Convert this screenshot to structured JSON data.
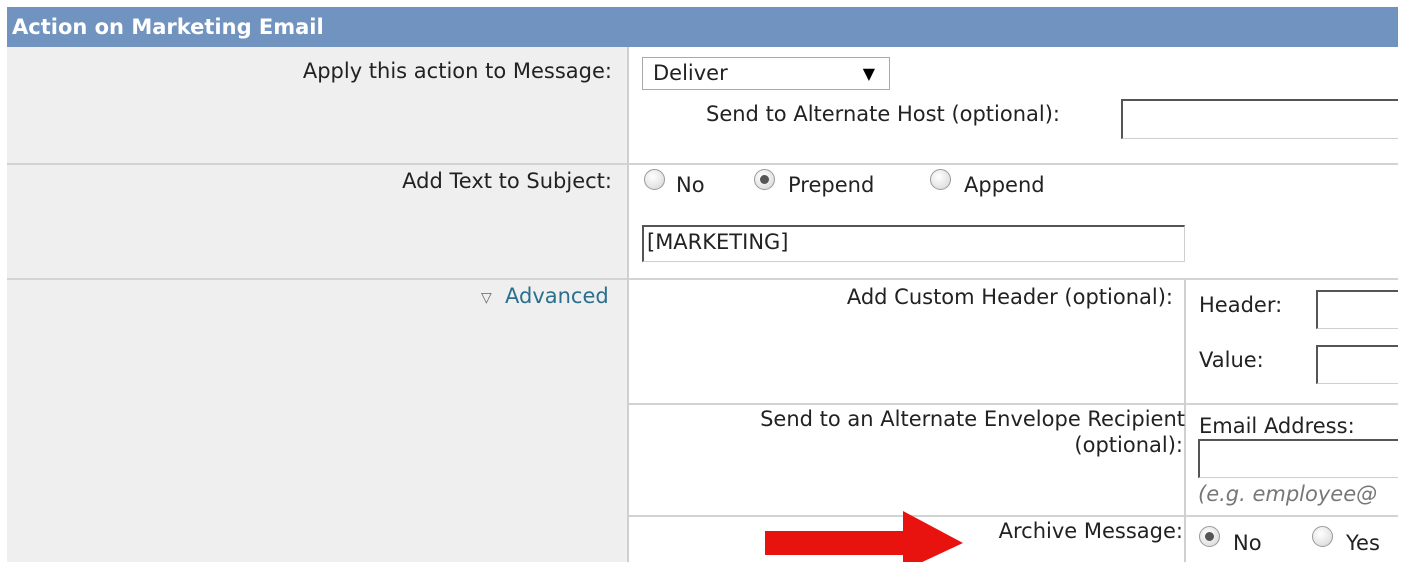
{
  "panel": {
    "title": "Action on Marketing Email"
  },
  "rows": {
    "apply_action": {
      "label": "Apply this action to Message:",
      "selected": "Deliver",
      "alt_host_label": "Send to Alternate Host (optional):",
      "alt_host_value": ""
    },
    "add_text": {
      "label": "Add Text to Subject:",
      "options": [
        {
          "label": "No",
          "checked": false
        },
        {
          "label": "Prepend",
          "checked": true
        },
        {
          "label": "Append",
          "checked": false
        }
      ],
      "text_value": "[MARKETING]"
    },
    "advanced": {
      "toggle_label": "Advanced",
      "custom_header": {
        "label": "Add Custom Header (optional):",
        "header_label": "Header:",
        "value_label": "Value:"
      },
      "alt_recipient": {
        "label_line1": "Send to an Alternate Envelope Recipient",
        "label_line2": "(optional):",
        "email_label": "Email Address:",
        "hint": "(e.g. employee@"
      },
      "archive": {
        "label": "Archive Message:",
        "options": [
          {
            "label": "No",
            "checked": true
          },
          {
            "label": "Yes",
            "checked": false
          }
        ]
      }
    }
  },
  "annotation": {
    "arrow_color": "#e8120f"
  }
}
